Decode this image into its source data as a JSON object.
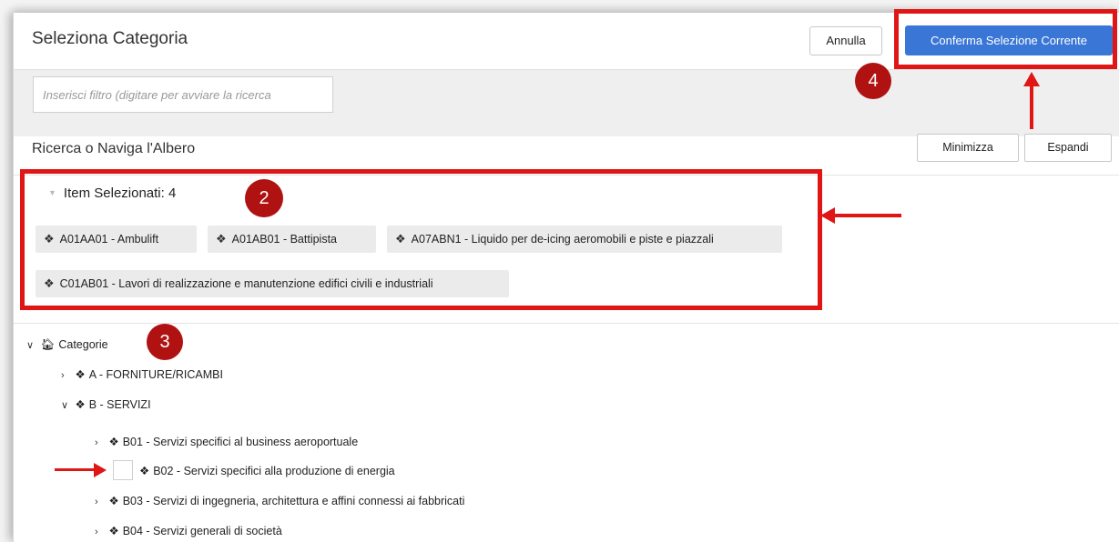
{
  "header": {
    "title": "Seleziona Categoria",
    "cancel_label": "Annulla",
    "confirm_label": "Conferma Selezione Corrente"
  },
  "filter": {
    "placeholder": "Inserisci filtro (digitare per avviare la ricerca",
    "value": ""
  },
  "navigator": {
    "title": "Ricerca o Naviga l'Albero",
    "minimize_label": "Minimizza",
    "expand_label": "Espandi"
  },
  "selected": {
    "header": "Item Selezionati: 4",
    "chips": [
      "A01AA01 - Ambulift",
      "A01AB01 - Battipista",
      "A07ABN1 - Liquido per de-icing aeromobili e piste e piazzali",
      "C01AB01 - Lavori di realizzazione e manutenzione edifici civili e industriali"
    ]
  },
  "tree": {
    "root": "Categorie",
    "nodes": [
      "A - FORNITURE/RICAMBI",
      "B - SERVIZI",
      "B01 - Servizi specifici al business aeroportuale",
      "B02 - Servizi specifici alla produzione di energia",
      "B03 - Servizi di ingegneria, architettura e affini connessi ai fabbricati",
      "B04 - Servizi generali di società"
    ]
  },
  "annotations": {
    "badge_2": "2",
    "badge_3": "3",
    "badge_4": "4",
    "color": "#e01515"
  },
  "colors": {
    "primary_button": "#3a76d6",
    "chip_bg": "#ebebeb",
    "filter_bar": "#efefef"
  }
}
